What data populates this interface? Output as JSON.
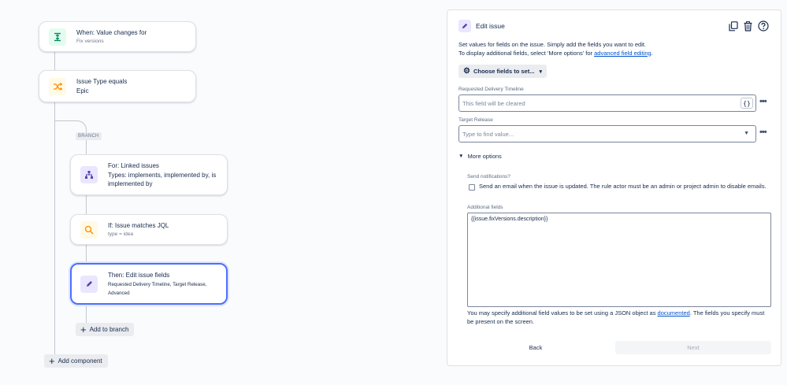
{
  "flow": {
    "trigger": {
      "title": "When: Value changes for",
      "subtitle": "Fix versions"
    },
    "condition": {
      "title": "Issue Type equals",
      "subtitle": "Epic"
    },
    "branch_tag": "BRANCH",
    "branch_node": {
      "title": "For: Linked issues",
      "subtitle": "Types: implements, implemented by, is implemented by"
    },
    "jql_node": {
      "title": "If: Issue matches JQL",
      "subtitle": "type = idea"
    },
    "action_node": {
      "title": "Then: Edit issue fields",
      "subtitle": "Requested Delivery Timeline, Target Release, Advanced"
    },
    "add_to_branch_label": "Add to branch",
    "add_component_label": "Add component"
  },
  "panel": {
    "title": "Edit issue",
    "intro_line1": "Set values for fields on the issue. Simply add the fields you want to edit.",
    "intro_line2_prefix": "To display additional fields, select 'More options' for ",
    "intro_link": "advanced field editing",
    "intro_line2_suffix": ".",
    "choose_fields_label": "Choose fields to set...",
    "requested_delivery": {
      "label": "Requested Delivery Timeline",
      "placeholder": "This field will be cleared",
      "braces": "{}"
    },
    "target_release": {
      "label": "Target Release",
      "placeholder": "Type to find value..."
    },
    "more_options_label": "More options",
    "send_notifications": {
      "label": "Send notifications?",
      "text": "Send an email when the issue is updated. The rule actor must be an admin or project admin to disable emails.",
      "checked": false
    },
    "additional_fields": {
      "label": "Additional fields",
      "value": "{{issue.fixVersions.description}}"
    },
    "hint_prefix": "You may specify additional field values to be set using a JSON object as ",
    "hint_link": "documented",
    "hint_suffix": ". The fields you specify must be present on the screen.",
    "back_label": "Back",
    "next_label": "Next"
  },
  "icons": {
    "trigger": "value-change-icon",
    "condition": "shuffle-icon",
    "branch": "branch-icon",
    "jql": "search-icon",
    "action": "pencil-icon",
    "copy": "copy-icon",
    "delete": "trash-icon",
    "help": "help-icon",
    "settings": "gear-icon",
    "more": "more-icon"
  },
  "colors": {
    "accent": "#4c6fff",
    "trigger_bg": "#e3fcef",
    "condition_bg": "#fffae6",
    "action_bg": "#eae6ff",
    "link": "#0052cc"
  }
}
